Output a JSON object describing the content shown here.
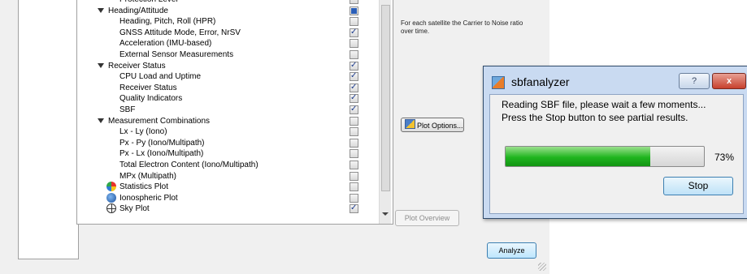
{
  "tree": {
    "rows": [
      {
        "label": "Protection Level",
        "indent": 2,
        "state": "unchecked",
        "icon": ""
      },
      {
        "label": "Heading/Attitude",
        "indent": 1,
        "state": "partial",
        "icon": "",
        "expander": true
      },
      {
        "label": "Heading, Pitch, Roll (HPR)",
        "indent": 2,
        "state": "unchecked",
        "icon": ""
      },
      {
        "label": "GNSS Attitude Mode, Error, NrSV",
        "indent": 2,
        "state": "checked",
        "icon": ""
      },
      {
        "label": "Acceleration (IMU-based)",
        "indent": 2,
        "state": "unchecked",
        "icon": ""
      },
      {
        "label": "External Sensor Measurements",
        "indent": 2,
        "state": "unchecked",
        "icon": ""
      },
      {
        "label": "Receiver Status",
        "indent": 1,
        "state": "checked",
        "icon": "",
        "expander": true
      },
      {
        "label": "CPU Load and Uptime",
        "indent": 2,
        "state": "checked",
        "icon": ""
      },
      {
        "label": "Receiver Status",
        "indent": 2,
        "state": "checked",
        "icon": ""
      },
      {
        "label": "Quality Indicators",
        "indent": 2,
        "state": "checked",
        "icon": ""
      },
      {
        "label": "SBF",
        "indent": 2,
        "state": "checked",
        "icon": ""
      },
      {
        "label": "Measurement Combinations",
        "indent": 1,
        "state": "unchecked",
        "icon": "",
        "expander": true
      },
      {
        "label": "Lx - Ly (Iono)",
        "indent": 2,
        "state": "unchecked",
        "icon": ""
      },
      {
        "label": "Px - Py (Iono/Multipath)",
        "indent": 2,
        "state": "unchecked",
        "icon": ""
      },
      {
        "label": "Px - Lx (Iono/Multipath)",
        "indent": 2,
        "state": "unchecked",
        "icon": ""
      },
      {
        "label": "Total Electron Content (Iono/Multipath)",
        "indent": 2,
        "state": "unchecked",
        "icon": ""
      },
      {
        "label": "MPx (Multipath)",
        "indent": 2,
        "state": "unchecked",
        "icon": ""
      },
      {
        "label": "Statistics Plot",
        "indent": 0,
        "state": "unchecked",
        "icon": "pie-chart-icon"
      },
      {
        "label": "Ionospheric Plot",
        "indent": 0,
        "state": "unchecked",
        "icon": "globe-icon"
      },
      {
        "label": "Sky Plot",
        "indent": 0,
        "state": "checked",
        "icon": "crosshair-icon"
      }
    ]
  },
  "side": {
    "description": "For each satellite the Carrier to Noise ratio over time.",
    "plot_options": "Plot Options...",
    "plot_overview": "Plot Overview"
  },
  "footer": {
    "analyze": "Analyze"
  },
  "dialog": {
    "title": "sbfanalyzer",
    "help": "?",
    "close": "x",
    "message_line1": "Reading SBF file, please wait a few moments...",
    "message_line2": "Press the Stop button to see partial results.",
    "progress": 73,
    "progress_text": "73%",
    "stop": "Stop"
  },
  "colors": {
    "progress_fill": "#1fb51f",
    "dialog_frame": "#c9daf1",
    "close_button": "#c7402d"
  }
}
